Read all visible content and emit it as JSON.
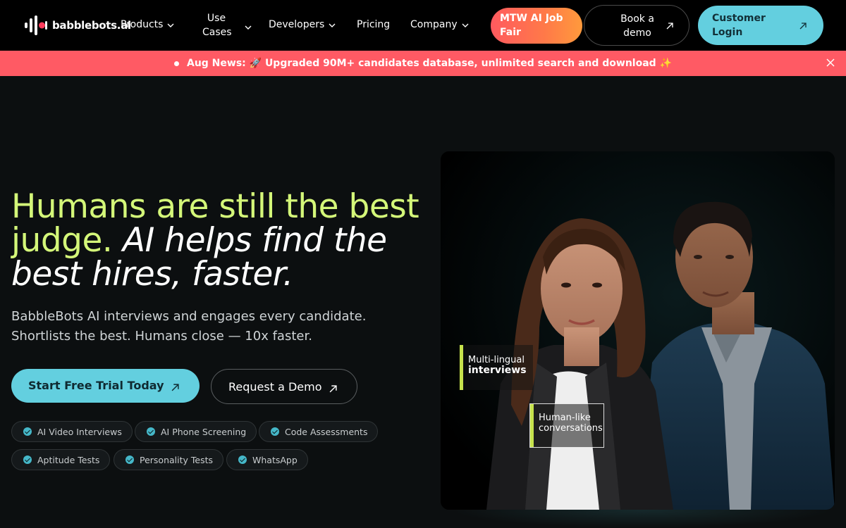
{
  "brand": {
    "name": "babblebots.ai",
    "logo_icon": "audio-wave-icon",
    "accent": "#ff3b5c"
  },
  "nav": {
    "products": "Products",
    "use_cases_line1": "Use",
    "use_cases_line2": "Cases",
    "developers": "Developers",
    "pricing": "Pricing",
    "company": "Company",
    "mtw_line1": "MTW AI Job",
    "mtw_line2": "Fair",
    "demo_line1": "Book a",
    "demo_line2": "demo",
    "login_line1": "Customer",
    "login_line2": "Login"
  },
  "announcement": {
    "text": "Aug News: 🚀 Upgraded 90M+ candidates database, unlimited search and download ✨",
    "background": "#ff5a64"
  },
  "hero": {
    "title_green": "Humans are still the best judge.",
    "title_italic": "AI helps find the best hires, faster.",
    "subtitle": "BabbleBots AI interviews and engages every candidate. Shortlists the best. Humans close — 10x faster.",
    "cta_primary": "Start Free Trial Today",
    "cta_secondary": "Request a Demo",
    "highlight_color": "#d4f779",
    "features": [
      "AI Video Interviews",
      "AI Phone Screening",
      "Code Assessments",
      "Aptitude Tests",
      "Personality Tests",
      "WhatsApp"
    ]
  },
  "media": {
    "tag_multilingual_line1": "Multi-lingual",
    "tag_multilingual_line2": "interviews",
    "tag_humanlike_line1": "Human-like",
    "tag_humanlike_line2": "conversations"
  }
}
